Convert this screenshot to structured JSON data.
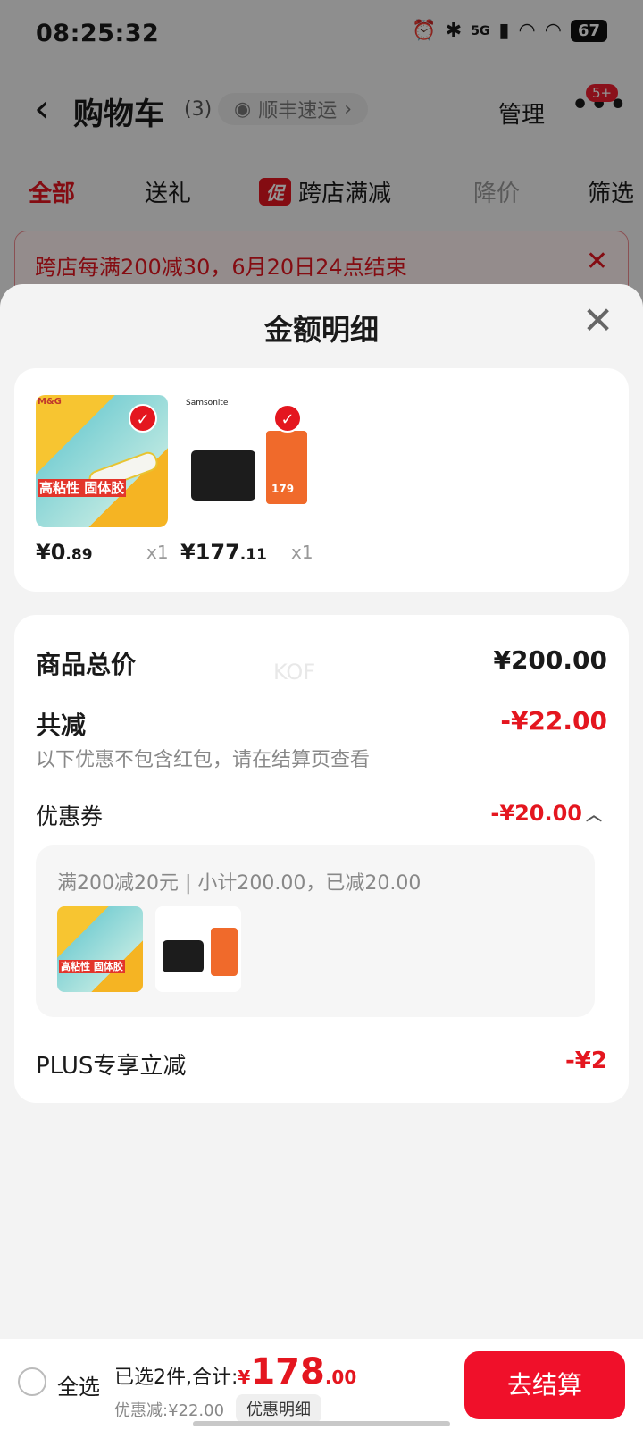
{
  "status_bar": {
    "time": "08:25:32",
    "signal": "5G",
    "battery": "67"
  },
  "nav": {
    "title": "购物车",
    "count": "(3)",
    "shipping_pill": "顺丰速运",
    "manage": "管理",
    "badge": "5+"
  },
  "tabs": [
    {
      "label": "全部",
      "active": true
    },
    {
      "label": "送礼"
    },
    {
      "label": "跨店满减",
      "chip": "促"
    },
    {
      "label": "降价"
    },
    {
      "label": "筛选"
    }
  ],
  "notice": {
    "text": "跨店每满200减30，6月20日24点结束"
  },
  "sheet": {
    "title": "金额明细",
    "products": [
      {
        "name": "glue-stick",
        "price_main": "¥0",
        "price_dec": ".89",
        "qty": "x1",
        "thumb_text": "高粘性 固体胶",
        "brand": "M&G"
      },
      {
        "name": "wallet",
        "price_main": "¥177",
        "price_dec": ".11",
        "qty": "x1",
        "brand": "Samsonite",
        "tag_price": "179"
      }
    ],
    "total_label": "商品总价",
    "total_value": "¥200.00",
    "reduce_label": "共减",
    "reduce_value": "-¥22.00",
    "note": "以下优惠不包含红包，请在结算页查看",
    "coupon_label": "优惠券",
    "coupon_value": "-¥20.00",
    "coupon_desc": "满200减20元 | 小计200.00，已减20.00",
    "plus_label": "PLUS专享立减",
    "plus_value": "-¥2",
    "watermark": "KOF"
  },
  "bottom_bar": {
    "select_all": "全选",
    "selected_text": "已选2件,合计:",
    "currency": "¥",
    "total_int": "178",
    "total_dec": ".00",
    "discount": "优惠减:¥22.00",
    "detail_button": "优惠明细",
    "checkout": "去结算"
  },
  "colors": {
    "accent": "#e4161f",
    "checkout": "#f0102a"
  }
}
